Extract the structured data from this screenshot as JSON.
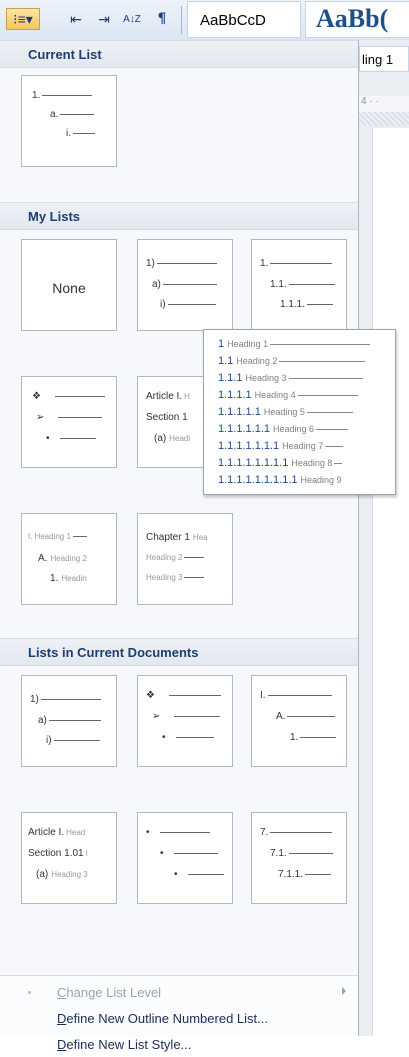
{
  "toolbar": {
    "multilevel_glyph": "⁝≡▾",
    "decrease_indent_glyph": "⇤",
    "increase_indent_glyph": "⇥",
    "sort_glyph": "A↓Z",
    "show_marks_glyph": "¶",
    "style_normal_preview": "AaBbCcD",
    "style_heading_preview": "AaBb("
  },
  "background": {
    "heading_label": "ling 1",
    "ruler_text": "4 · ·"
  },
  "sections": {
    "current_list": "Current List",
    "my_lists": "My Lists",
    "lists_in_doc": "Lists in Current Documents"
  },
  "tiles": {
    "current": {
      "l1": "1.",
      "l2": "a.",
      "l3": "i."
    },
    "none": "None",
    "paren": {
      "l1": "1)",
      "l2": "a)",
      "l3": "i)"
    },
    "legal": {
      "l1": "1.",
      "l2": "1.1.",
      "l3": "1.1.1."
    },
    "bullets": {
      "l1": "❖",
      "l2": "➢",
      "l3": "•"
    },
    "article": {
      "l1": "Article I.",
      "l1b": "H",
      "l2": "Section 1",
      "l3": "(a)",
      "l3b": "Headi"
    },
    "roman_head": {
      "l1": "I.",
      "l1b": "Heading 1",
      "l2": "A.",
      "l2b": "Heading 2",
      "l3": "1.",
      "l3b": "Headin"
    },
    "chapter": {
      "l1": "Chapter 1",
      "l1b": "Hea",
      "l2": "Heading 2",
      "l3": "Heading 3"
    },
    "doc_paren": {
      "l1": "1)",
      "l2": "a)",
      "l3": "i)"
    },
    "doc_bullets": {
      "l1": "❖",
      "l2": "➢",
      "l3": "•"
    },
    "doc_roman": {
      "l1": "I.",
      "l2": "A.",
      "l3": "1."
    },
    "doc_article": {
      "l1": "Article I.",
      "l1b": "Head",
      "l2": "Section 1.01",
      "l2b": "I",
      "l3": "(a)",
      "l3b": "Heading 3"
    },
    "doc_dots": {
      "l1": "•",
      "l2": "•",
      "l3": "•"
    },
    "doc_seven": {
      "l1": "7.",
      "l2": "7.1.",
      "l3": "7.1.1."
    }
  },
  "tooltip": {
    "rows": [
      {
        "num": "1",
        "label": "Heading 1"
      },
      {
        "num": "1.1",
        "label": "Heading 2"
      },
      {
        "num": "1.1.1",
        "label": "Heading 3"
      },
      {
        "num": "1.1.1.1",
        "label": "Heading 4"
      },
      {
        "num": "1.1.1.1.1",
        "label": "Heading 5"
      },
      {
        "num": "1.1.1.1.1.1",
        "label": "Heading 6"
      },
      {
        "num": "1.1.1.1.1.1.1",
        "label": "Heading 7"
      },
      {
        "num": "1.1.1.1.1.1.1.1",
        "label": "Heading 8"
      },
      {
        "num": "1.1.1.1.1.1.1.1.1",
        "label": "Heading 9"
      }
    ]
  },
  "menu": {
    "change_level": {
      "mnem": "C",
      "rest": "hange List Level"
    },
    "define_outline": {
      "mnem": "D",
      "rest": "efine New Outline Numbered List..."
    },
    "define_style": {
      "mnem": "D",
      "rest": "efine New List Style..."
    }
  }
}
